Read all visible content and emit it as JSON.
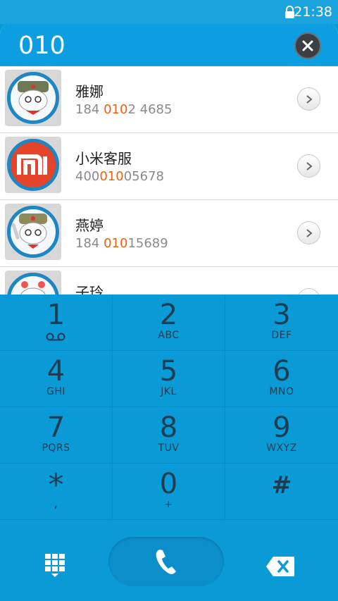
{
  "status": {
    "time": "21:38",
    "lock_icon": "lock-icon"
  },
  "header": {
    "dialed_number": "010",
    "clear_icon": "close-icon"
  },
  "contacts": [
    {
      "name": "雅娜",
      "number_parts": [
        "184 ",
        "010",
        "2 4685"
      ]
    },
    {
      "name": "小米客服",
      "number_parts": [
        "400",
        "010",
        "05678"
      ]
    },
    {
      "name": "燕婷",
      "number_parts": [
        "184 ",
        "010",
        "15689"
      ]
    },
    {
      "name": "子玲",
      "number_parts": [
        "",
        "",
        ""
      ]
    }
  ],
  "keypad": [
    {
      "digit": "1",
      "letters": ""
    },
    {
      "digit": "2",
      "letters": "ABC"
    },
    {
      "digit": "3",
      "letters": "DEF"
    },
    {
      "digit": "4",
      "letters": "GHI"
    },
    {
      "digit": "5",
      "letters": "JKL"
    },
    {
      "digit": "6",
      "letters": "MNO"
    },
    {
      "digit": "7",
      "letters": "PQRS"
    },
    {
      "digit": "8",
      "letters": "TUV"
    },
    {
      "digit": "9",
      "letters": "WXYZ"
    },
    {
      "digit": "*",
      "letters": ","
    },
    {
      "digit": "0",
      "letters": "+"
    },
    {
      "digit": "#",
      "letters": ""
    }
  ],
  "bottom_bar": {
    "left_icon": "dialpad-grid-icon",
    "center_icon": "phone-icon",
    "right_icon": "backspace-icon"
  },
  "colors": {
    "accent": "#0a9ad6",
    "highlight": "#e8620f",
    "key_text": "#1c3d52"
  }
}
